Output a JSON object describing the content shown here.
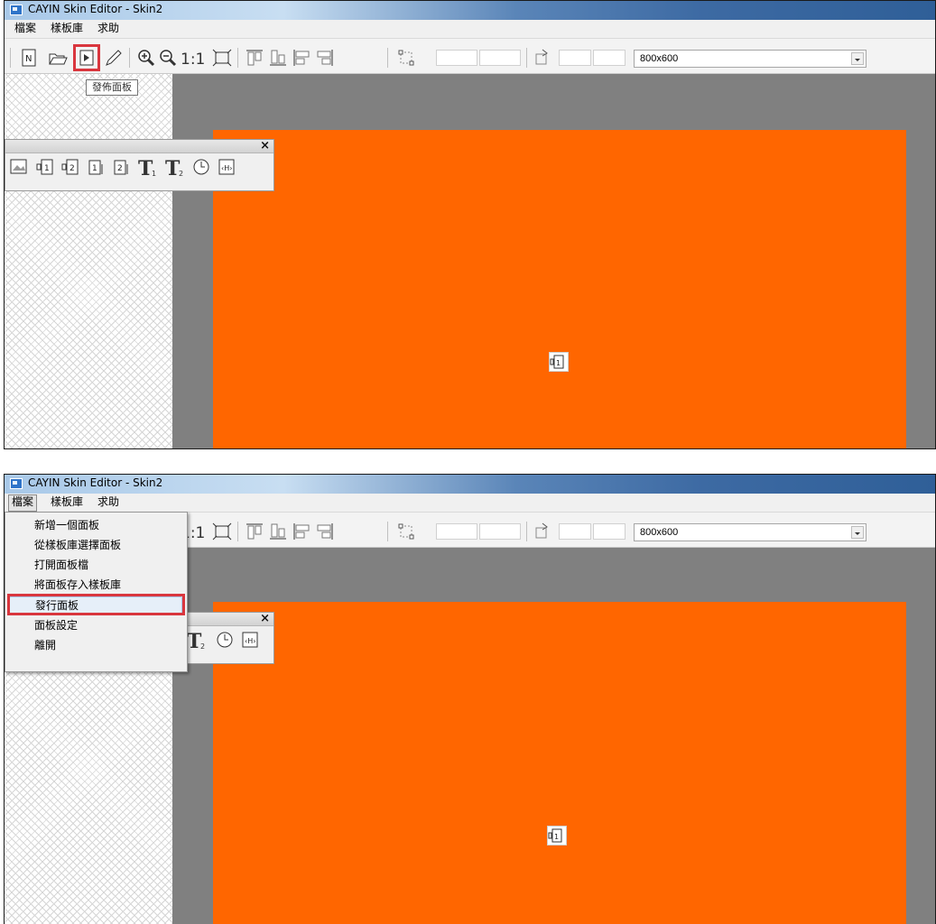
{
  "window": {
    "title": "CAYIN Skin Editor - Skin2"
  },
  "menubar": {
    "file": "檔案",
    "library": "樣板庫",
    "help": "求助"
  },
  "toolbar": {
    "resolution": "800x600"
  },
  "tooltip": {
    "publish": "發佈面板"
  },
  "file_menu": {
    "items": [
      "新增一個面板",
      "從樣板庫選擇面板",
      "打開面板檔",
      "將面板存入樣板庫",
      "發行面板",
      "面板設定",
      "離開"
    ],
    "highlighted_index": 4
  },
  "palette": {
    "close": "×"
  },
  "colors": {
    "canvas": "#ff6600",
    "workspace": "#808080",
    "highlight": "#d9363e"
  },
  "icons": {
    "toolbar": [
      "new-icon",
      "open-icon",
      "publish-icon",
      "pencil-icon",
      "zoom-in-icon",
      "zoom-out-icon",
      "actual-size-icon",
      "fit-window-icon",
      "align-top-icon",
      "align-bottom-icon",
      "align-left-icon",
      "align-right-icon",
      "resize-icon",
      "rotate-icon"
    ],
    "palette": [
      "image-icon",
      "video1-icon",
      "video2-icon",
      "media1-icon",
      "media2-icon",
      "text1-icon",
      "text2-icon",
      "clock-icon",
      "flash-icon"
    ]
  }
}
